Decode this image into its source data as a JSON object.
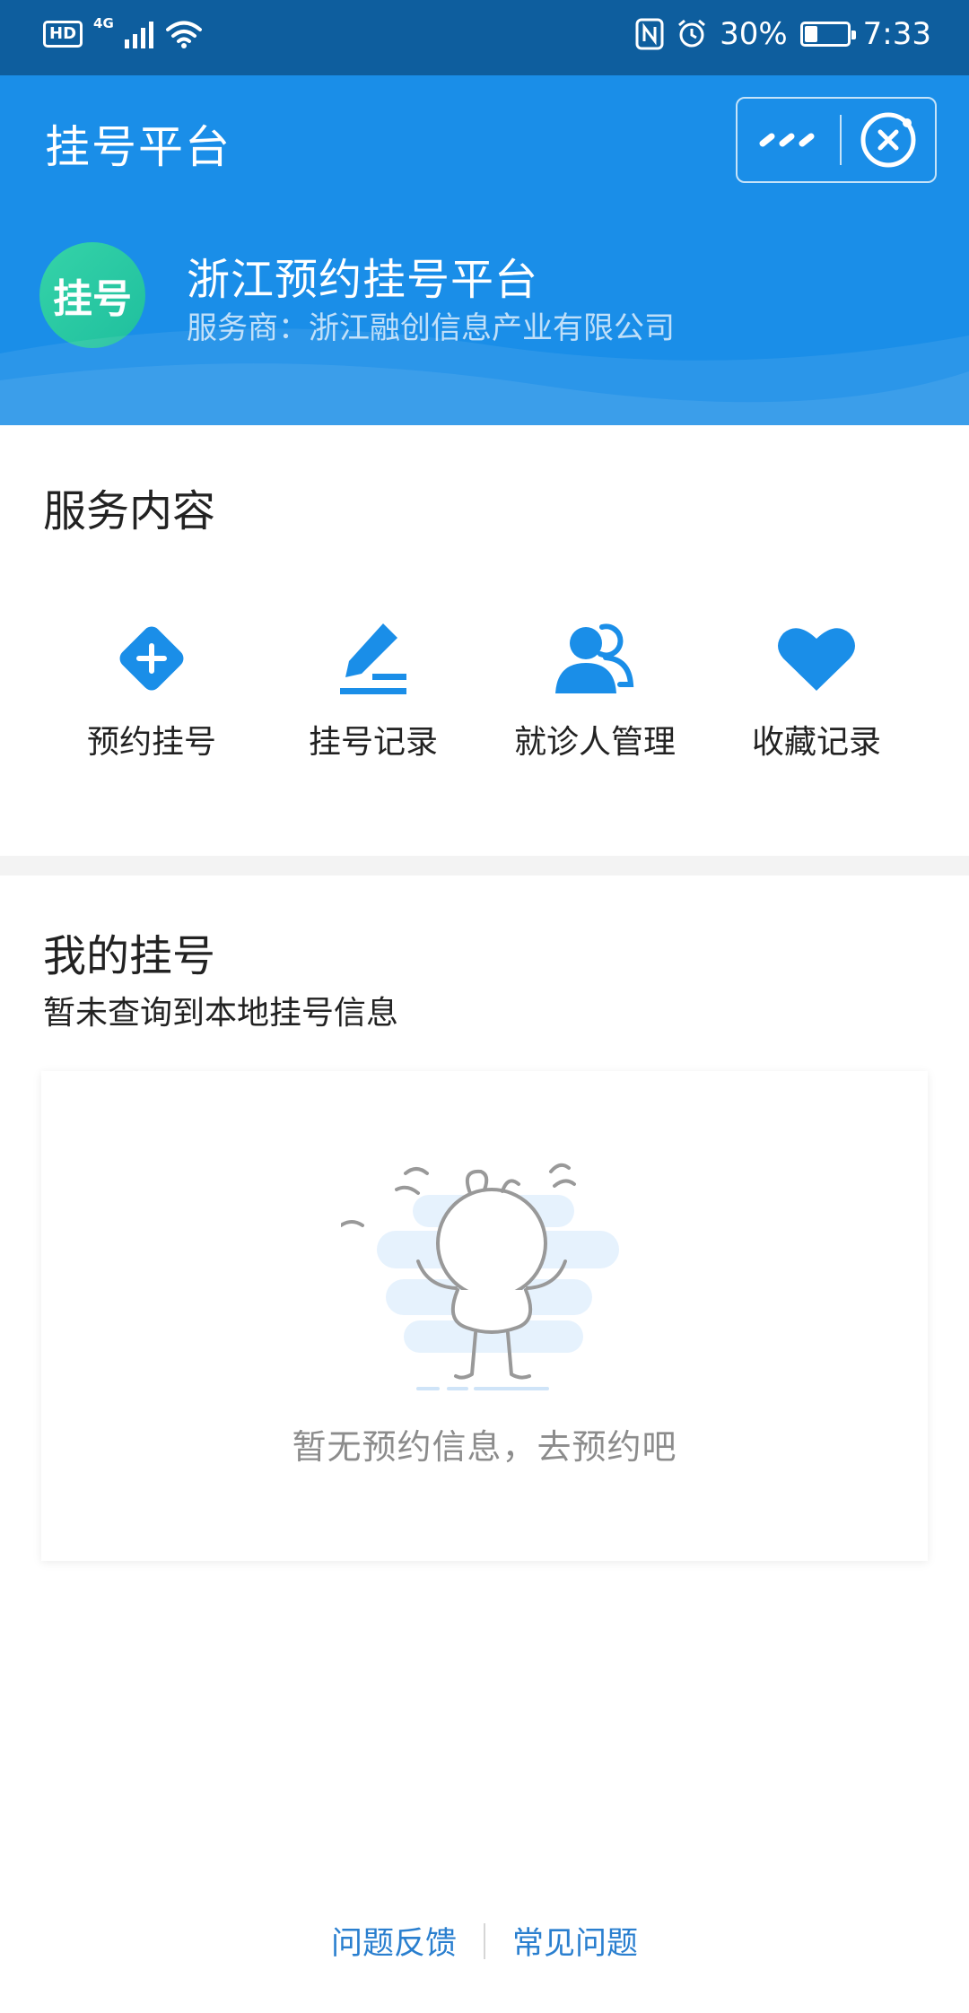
{
  "status_bar": {
    "hd": "HD",
    "network": "4G",
    "battery_percent": "30%",
    "battery_level": 0.3,
    "time": "7:33"
  },
  "header": {
    "title": "挂号平台",
    "provider_name": "浙江预约挂号平台",
    "provider_sub": "服务商：浙江融创信息产业有限公司",
    "logo_text": "挂号",
    "accent": "#1a8ee8"
  },
  "service": {
    "title": "服务内容",
    "items": [
      {
        "label": "预约挂号",
        "icon": "plus-diamond-icon"
      },
      {
        "label": "挂号记录",
        "icon": "edit-icon"
      },
      {
        "label": "就诊人管理",
        "icon": "users-icon"
      },
      {
        "label": "收藏记录",
        "icon": "heart-icon"
      }
    ]
  },
  "mine": {
    "title": "我的挂号",
    "subtitle": "暂未查询到本地挂号信息",
    "empty_text": "暂无预约信息，去预约吧"
  },
  "footer": {
    "feedback": "问题反馈",
    "faq": "常见问题"
  }
}
